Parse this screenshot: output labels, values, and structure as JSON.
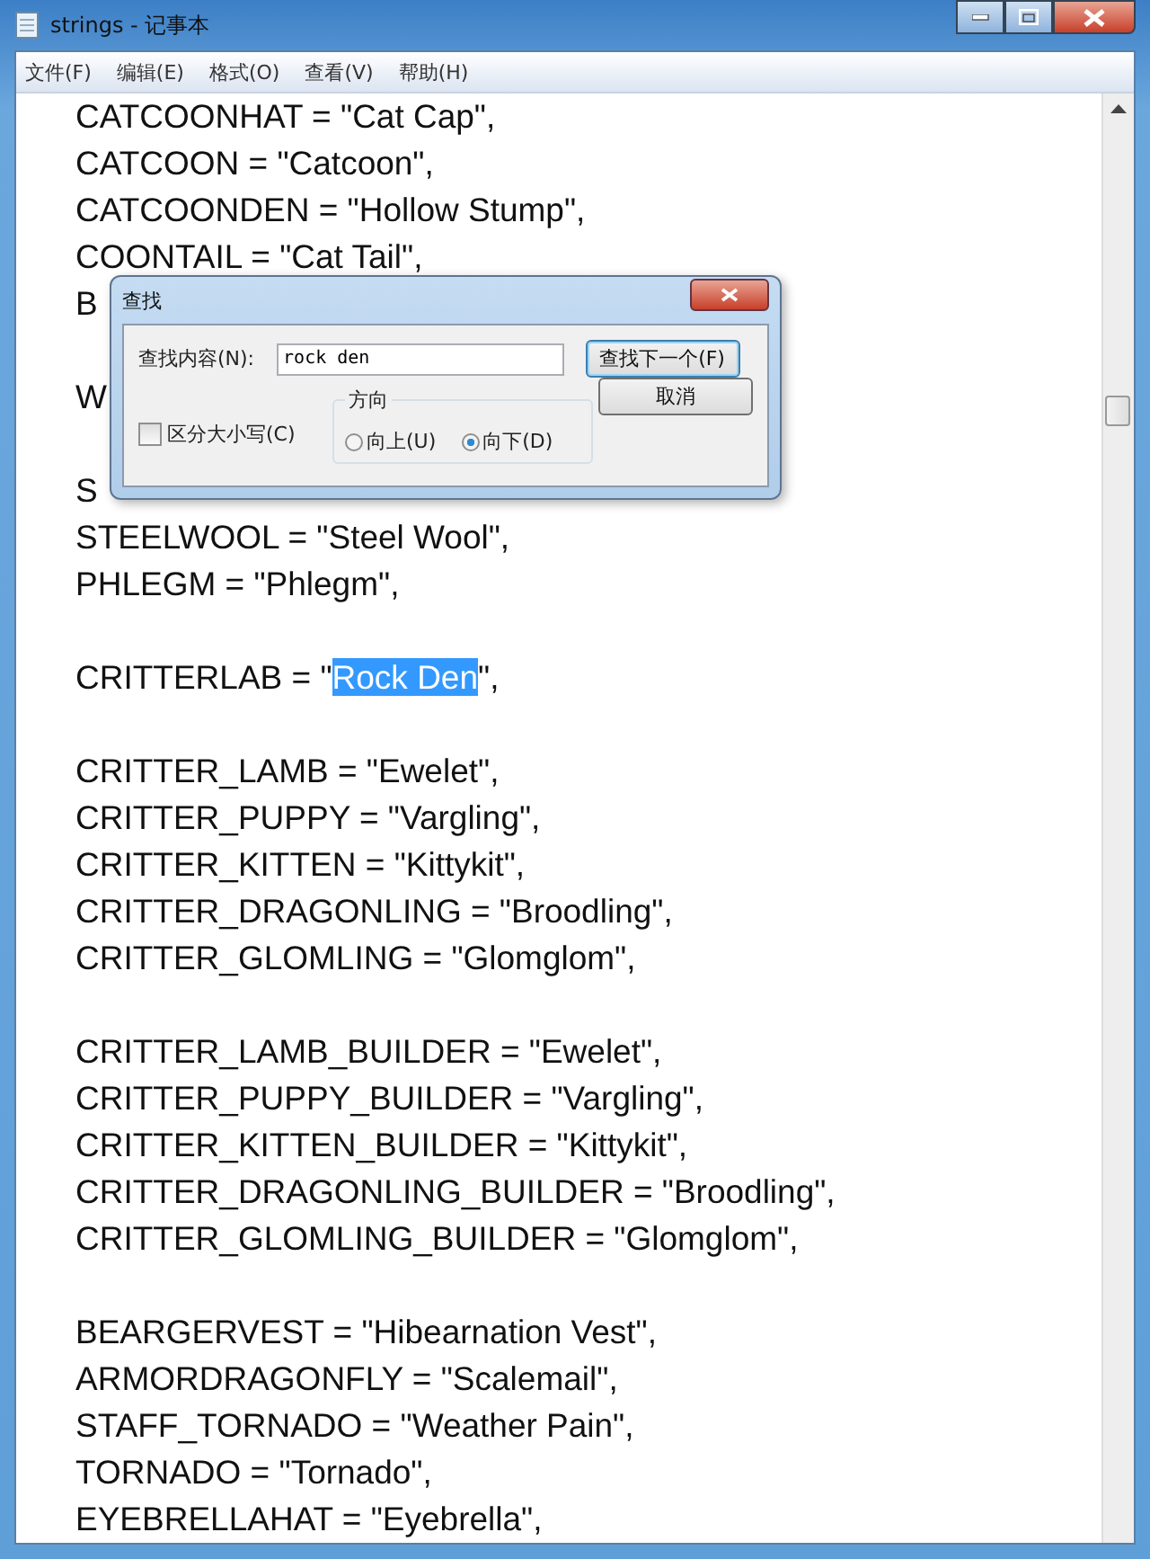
{
  "window": {
    "title": "strings - 记事本"
  },
  "menu": [
    "文件(F)",
    "编辑(E)",
    "格式(O)",
    "查看(V)",
    "帮助(H)"
  ],
  "editor": {
    "lines": [
      {
        "kind": "text",
        "text": "CATCOONHAT = \"Cat Cap\","
      },
      {
        "kind": "text",
        "text": "CATCOON = \"Catcoon\","
      },
      {
        "kind": "text",
        "text": "CATCOONDEN = \"Hollow Stump\","
      },
      {
        "kind": "text",
        "text": "COONTAIL = \"Cat Tail\","
      },
      {
        "kind": "text",
        "text": "B"
      },
      {
        "kind": "blank"
      },
      {
        "kind": "text",
        "text": "W"
      },
      {
        "kind": "blank"
      },
      {
        "kind": "text",
        "text": "S"
      },
      {
        "kind": "text",
        "text": "STEELWOOL = \"Steel Wool\","
      },
      {
        "kind": "text",
        "text": "PHLEGM = \"Phlegm\","
      },
      {
        "kind": "blank"
      },
      {
        "kind": "selection",
        "before": "CRITTERLAB = \"",
        "selected": "Rock Den",
        "after": "\","
      },
      {
        "kind": "blank"
      },
      {
        "kind": "text",
        "text": "CRITTER_LAMB = \"Ewelet\","
      },
      {
        "kind": "text",
        "text": "CRITTER_PUPPY = \"Vargling\","
      },
      {
        "kind": "text",
        "text": "CRITTER_KITTEN = \"Kittykit\","
      },
      {
        "kind": "text",
        "text": "CRITTER_DRAGONLING = \"Broodling\","
      },
      {
        "kind": "text",
        "text": "CRITTER_GLOMLING = \"Glomglom\","
      },
      {
        "kind": "blank"
      },
      {
        "kind": "text",
        "text": "CRITTER_LAMB_BUILDER = \"Ewelet\","
      },
      {
        "kind": "text",
        "text": "CRITTER_PUPPY_BUILDER = \"Vargling\","
      },
      {
        "kind": "text",
        "text": "CRITTER_KITTEN_BUILDER = \"Kittykit\","
      },
      {
        "kind": "text",
        "text": "CRITTER_DRAGONLING_BUILDER = \"Broodling\","
      },
      {
        "kind": "text",
        "text": "CRITTER_GLOMLING_BUILDER = \"Glomglom\","
      },
      {
        "kind": "blank"
      },
      {
        "kind": "text",
        "text": "BEARGERVEST = \"Hibearnation Vest\","
      },
      {
        "kind": "text",
        "text": "ARMORDRAGONFLY = \"Scalemail\","
      },
      {
        "kind": "text",
        "text": "STAFF_TORNADO = \"Weather Pain\","
      },
      {
        "kind": "text",
        "text": "TORNADO = \"Tornado\","
      },
      {
        "kind": "text",
        "text": "EYEBRELLAHAT = \"Eyebrella\","
      }
    ]
  },
  "find_dialog": {
    "title": "查找",
    "find_label": "查找内容(N):",
    "find_value": "rock den",
    "find_next_button": "查找下一个(F)",
    "cancel_button": "取消",
    "match_case": {
      "label": "区分大小写(C)",
      "checked": false
    },
    "direction": {
      "label": "方向",
      "options": [
        {
          "label": "向上(U)",
          "selected": false
        },
        {
          "label": "向下(D)",
          "selected": true
        }
      ]
    }
  }
}
